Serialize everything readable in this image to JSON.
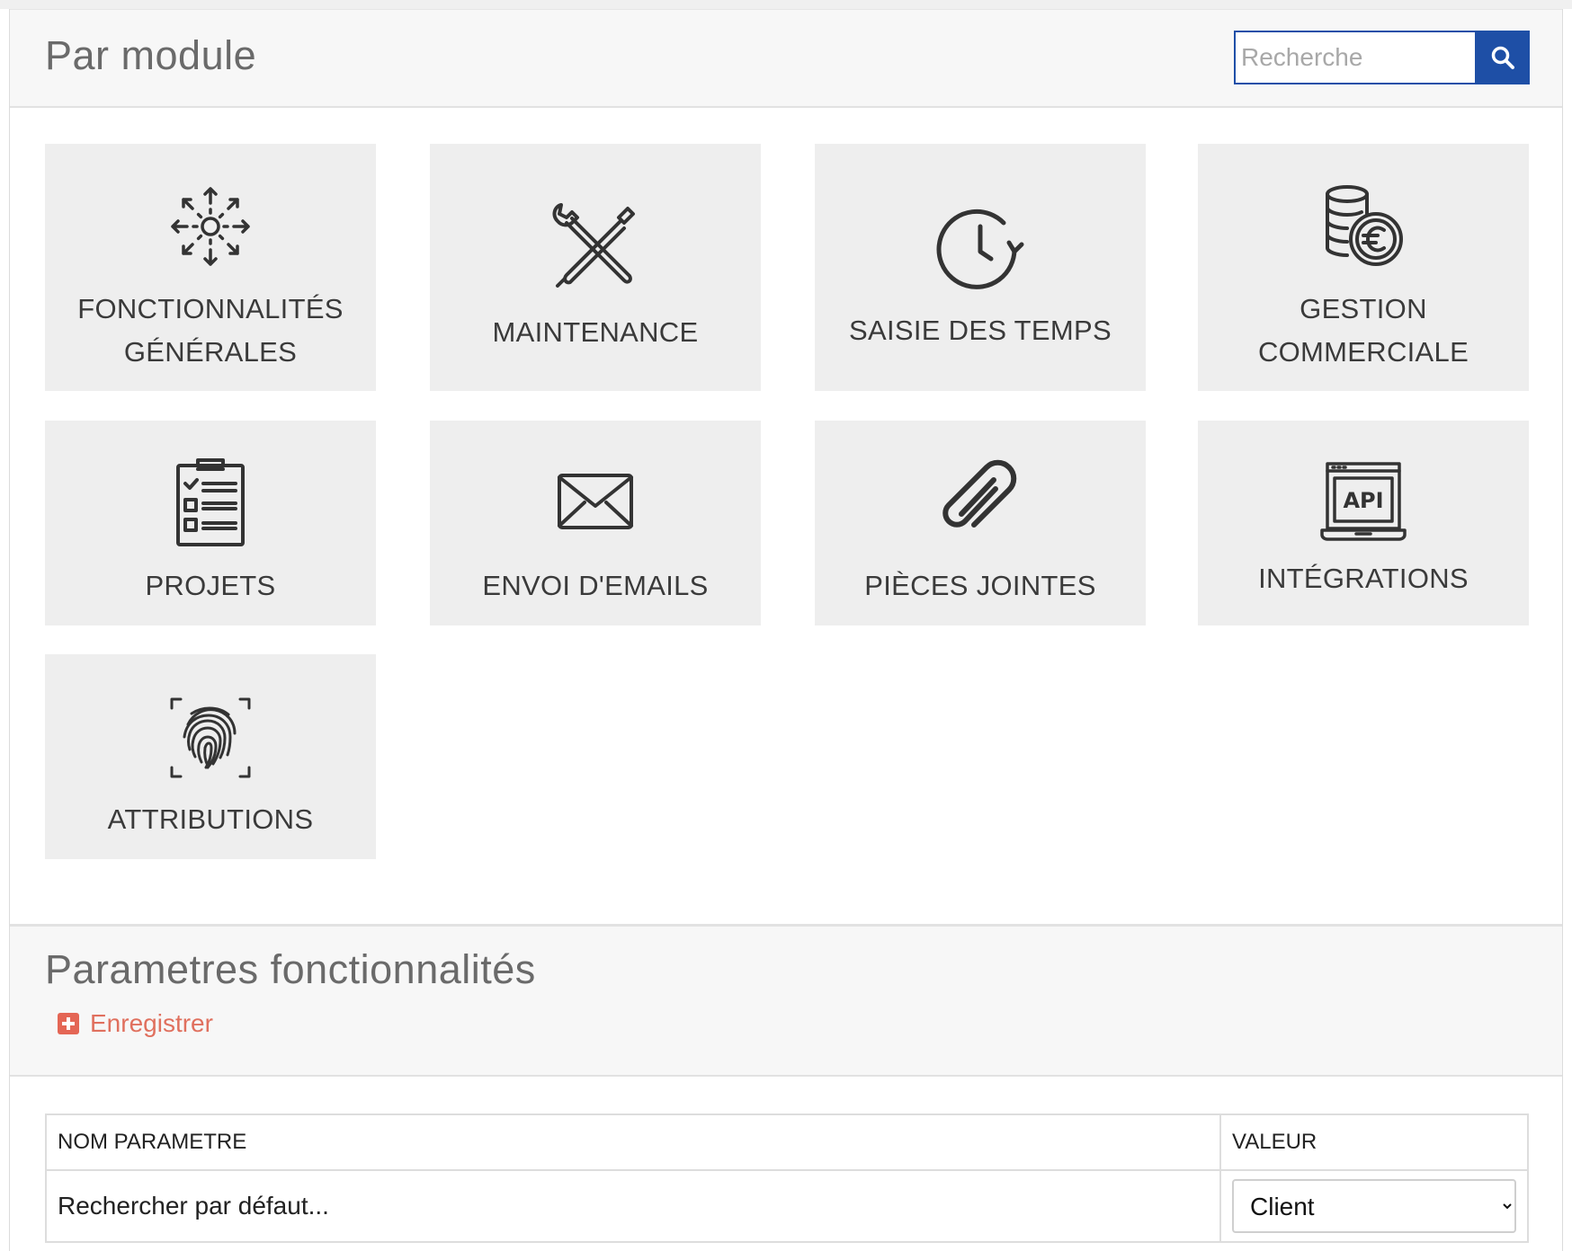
{
  "module_panel": {
    "title": "Par module",
    "search": {
      "placeholder": "Recherche",
      "value": ""
    },
    "tiles": [
      {
        "label": "FONCTIONNALITÉS\nGÉNÉRALES",
        "icon": "gear-arrows-icon"
      },
      {
        "label": "MAINTENANCE",
        "icon": "wrench-screwdriver-icon"
      },
      {
        "label": "SAISIE DES TEMPS",
        "icon": "clock-refresh-icon"
      },
      {
        "label": "GESTION\nCOMMERCIALE",
        "icon": "coins-euro-icon"
      },
      {
        "label": "PROJETS",
        "icon": "clipboard-checklist-icon"
      },
      {
        "label": "ENVOI D'EMAILS",
        "icon": "envelope-icon"
      },
      {
        "label": "PIÈCES JOINTES",
        "icon": "paperclip-icon"
      },
      {
        "label": "INTÉGRATIONS",
        "icon": "api-laptop-icon"
      },
      {
        "label": "ATTRIBUTIONS",
        "icon": "fingerprint-icon"
      }
    ]
  },
  "params_panel": {
    "title": "Parametres fonctionnalités",
    "save_label": "Enregistrer",
    "table": {
      "headers": [
        "NOM PARAMETRE",
        "VALEUR"
      ],
      "rows": [
        {
          "name": "Rechercher par défaut...",
          "value": "Client"
        }
      ]
    }
  },
  "colors": {
    "accent": "#1e4fa6",
    "save": "#e46655",
    "tile_bg": "#eeeeee"
  }
}
